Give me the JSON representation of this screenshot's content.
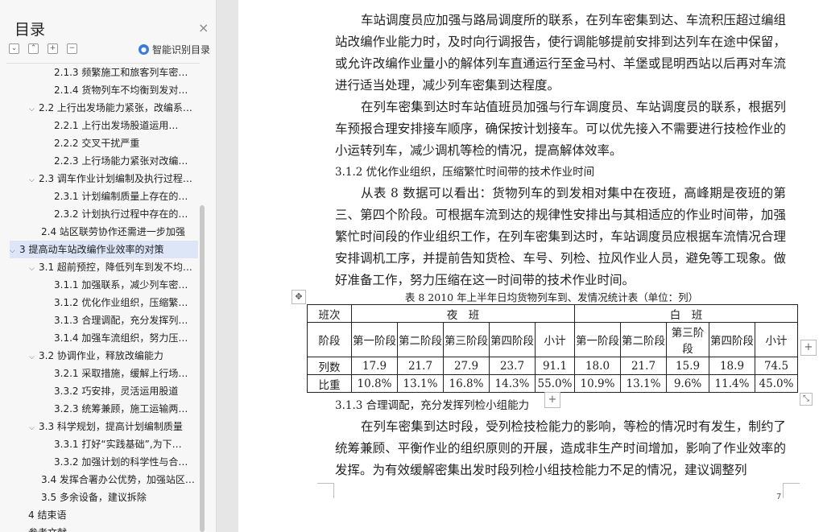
{
  "sidebar": {
    "title": "目录",
    "close": "×",
    "tools": [
      "⌄",
      "⌃",
      "+",
      "−"
    ],
    "smart_label": "智能识别目录",
    "toc": [
      {
        "label": "2.1.3 频繁施工和旅客列车密…"
      },
      {
        "label": "2.1.4 货物列车不均衡到发对…"
      },
      {
        "label": "2.2 上行出发场能力紧张，改编系…"
      },
      {
        "label": "2.2.1 上行出发场股道运用…"
      },
      {
        "label": "2.2.2 交叉干扰严重"
      },
      {
        "label": "2.2.3 上行场能力紧张对改编…"
      },
      {
        "label": "2.3 调车作业计划编制及执行过程…"
      },
      {
        "label": "2.3.1 计划编制质量上存在的…"
      },
      {
        "label": "2.3.2 计划执行过程中存在的…"
      },
      {
        "label": "2.4 站区联劳协作还需进一步加强"
      },
      {
        "label": "3   提高动车站改编作业效率的对策"
      },
      {
        "label": "3.1 超前预控，降低列车到发不均…"
      },
      {
        "label": "3.1.1 加强联系，减少列车密…"
      },
      {
        "label": "3.1.2 优化作业组织，压缩繁…"
      },
      {
        "label": "3.1.3 合理调配，充分发挥列…"
      },
      {
        "label": "3.1.4 加强车流组织，努力压…"
      },
      {
        "label": "3.2 协调作业，释放改编能力"
      },
      {
        "label": "3.2.1 采取措施，缓解上行场…"
      },
      {
        "label": "3.3.2 巧安排，灵活运用股道"
      },
      {
        "label": "3.2.3 统筹兼顾，施工运输两…"
      },
      {
        "label": "3.3 科学规划，提高计划编制质量"
      },
      {
        "label": "3.3.1 打好“实践基础”,为下…"
      },
      {
        "label": "3.3.2 加强计划的科学性与合…"
      },
      {
        "label": "3.4 发挥合署办公优势，加强站区…"
      },
      {
        "label": "3.5 多余设备，建议拆除"
      },
      {
        "label": "4   结束语"
      },
      {
        "label": "参考文献"
      }
    ]
  },
  "document": {
    "para1": "车站调度员应加强与路局调度所的联系，在列车密集到达、车流积压超过编组站改编作业能力时，及时向行调报告，使行调能够提前安排到达列车在途中保留，或允许改编作业量小的解体列车直通运行至金马村、羊堡或昆明西站以后再对车流进行适当处理，减少列车密集到达程度。",
    "para2": "在列车密集到达时车站值班员加强与行车调度员、车站调度员的联系，根据列车预报合理安排接车顺序，确保按计划接车。可以优先接入不需要进行技检作业的小运转列车，减少调机等检的情况，提高解体效率。",
    "heading1": "3.1.2 优化作业组织，压缩繁忙时间带的技术作业时间",
    "para3": "从表 8 数据可以看出：货物列车的到发相对集中在夜班，高峰期是夜班的第三、第四个阶段。可根据车流到达的规律性安排出与其相适应的作业时间带，加强繁忙时间段的作业组织工作，在列车密集到达时，车站调度员应根据车流情况合理安排调机工序，并提前告知货检、车号、列检、拉风作业人员，避免等工现象。做好准备工作，努力压缩在这一时间带的技术作业时间。",
    "table_caption": "表 8  2010 年上半年日均货物列车到、发情况统计表（单位：列）",
    "table": {
      "col_shift_header": "班次",
      "night": "夜　班",
      "day": "白　班",
      "stage_header": "阶段",
      "stages": [
        "第一阶段",
        "第二阶段",
        "第三阶段",
        "第四阶段",
        "小计",
        "第一阶段",
        "第二阶段",
        "第三阶段",
        "第四阶段",
        "小计"
      ],
      "row1_label": "列数",
      "row1": [
        "17.9",
        "21.7",
        "27.9",
        "23.7",
        "91.1",
        "18.0",
        "21.7",
        "15.9",
        "18.9",
        "74.5"
      ],
      "row2_label": "比重",
      "row2": [
        "10.8%",
        "13.1%",
        "16.8%",
        "14.3%",
        "55.0%",
        "10.9%",
        "13.1%",
        "9.6%",
        "11.4%",
        "45.0%"
      ]
    },
    "heading2": "3.1.3 合理调配，充分发挥列检小组能力",
    "para4": "在列车密集到达时段，受列检技检能力的影响，等检的情况时有发生，制约了统筹兼顾、平衡作业的组织原则的开展，造成非生产时间增加，影响了作业效率的发挥。为有效缓解密集出发时段列检小组技检能力不足的情况，建议调整列",
    "page_number": "7"
  }
}
